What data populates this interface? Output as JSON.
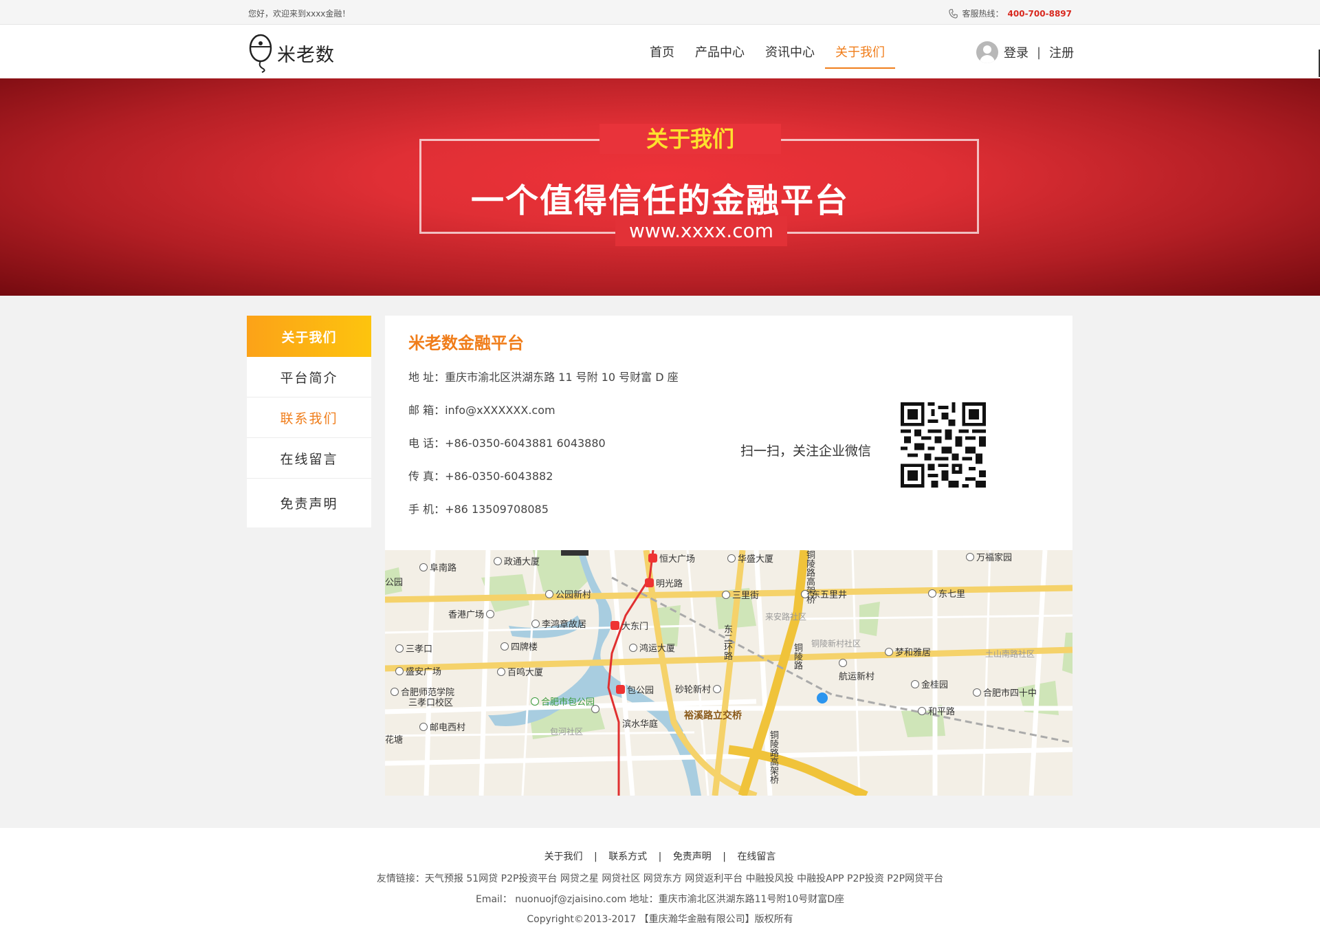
{
  "topbar": {
    "welcome": "您好，欢迎来到xxxx金融！",
    "hotline_label": "客服热线：",
    "hotline_number": "400-700-8897"
  },
  "header": {
    "brand": "米老数",
    "nav": [
      "首页",
      "产品中心",
      "资讯中心",
      "关于我们"
    ],
    "active_nav": "关于我们",
    "login": "登录",
    "separator": "|",
    "register": "注册"
  },
  "banner": {
    "top_title": "关于我们",
    "main_title": "一个值得信任的金融平台",
    "url": "www.xxxx.com"
  },
  "sidebar": {
    "head": "关于我们",
    "items": [
      "平台简介",
      "联系我们",
      "在线留言",
      "免责声明"
    ],
    "active_item": "联系我们"
  },
  "contact": {
    "title": "米老数金融平台",
    "address": "地 址：重庆市渝北区洪湖东路 11 号附 10 号财富 D 座",
    "email": "邮 箱：info@xXXXXXX.com",
    "phone": "电 话：+86-0350-6043881 6043880",
    "fax": "传 真：+86-0350-6043882",
    "mobile": "手 机：+86 13509708085",
    "qr_caption": "扫一扫，关注企业微信"
  },
  "map": {
    "labels": {
      "funan": "阜南路",
      "zhengtong": "政通大厦",
      "hengda": "恒大广场",
      "huasheng": "华盛大厦",
      "wanfu": "万福家园",
      "mingguang": "明光路",
      "gongyuan": "公园新村",
      "sanlijie": "三里街",
      "dongwulijie": "东五里井",
      "dongqili": "东七里",
      "xianggang": "香港广场",
      "lihongzhang": "李鸿章故居",
      "dadongmen": "大东门",
      "laian": "来安路社区",
      "sanxiaokou": "三孝口",
      "sipailou": "四牌楼",
      "hongyun": "鸿运大厦",
      "tongling_she": "铜陵新村社区",
      "mengheyaju": "梦和雅居",
      "tushan": "土山南路社区",
      "shengan": "盛安广场",
      "baiming": "百鸣大厦",
      "hangyun": "航运新村",
      "jingui": "金桂园",
      "shifan": "合肥师范学院",
      "shifan2": "三孝口校区",
      "baohe": "包公园",
      "shalun": "砂轮新村",
      "sishizhong": "合肥市四十中",
      "baohepark": "合肥市包公园",
      "yuxi": "裕溪路立交桥",
      "heping": "和平路",
      "youdian": "邮电西村",
      "binshui": "滨水华庭",
      "baohe_she": "包河社区",
      "huatang": "花塘",
      "gongyuan_edge": "公园",
      "donghuan": "东二环路",
      "tongling_gao": "铜陵路高架桥",
      "tongling_lu": "铜陵路",
      "tongling_gao2": "铜陵路高架桥"
    }
  },
  "footer": {
    "links": [
      "关于我们",
      "联系方式",
      "免责声明",
      "在线留言"
    ],
    "friends": "友情链接：天气预报 51网贷 P2P投资平台 网贷之星 网贷社区 网贷东方 网贷返利平台 中融投风投 中融投APP  P2P投资 P2P网贷平台",
    "contact": "Email：  nuonuojf@zjaisino.com    地址：重庆市渝北区洪湖东路11号附10号财富D座",
    "copyright": "Copyright©2013-2017  【重庆瀚华金融有限公司】版权所有"
  },
  "colors": {
    "accent": "#f07d1a",
    "banner_red": "#e8333a",
    "hotline": "#d8281e"
  }
}
